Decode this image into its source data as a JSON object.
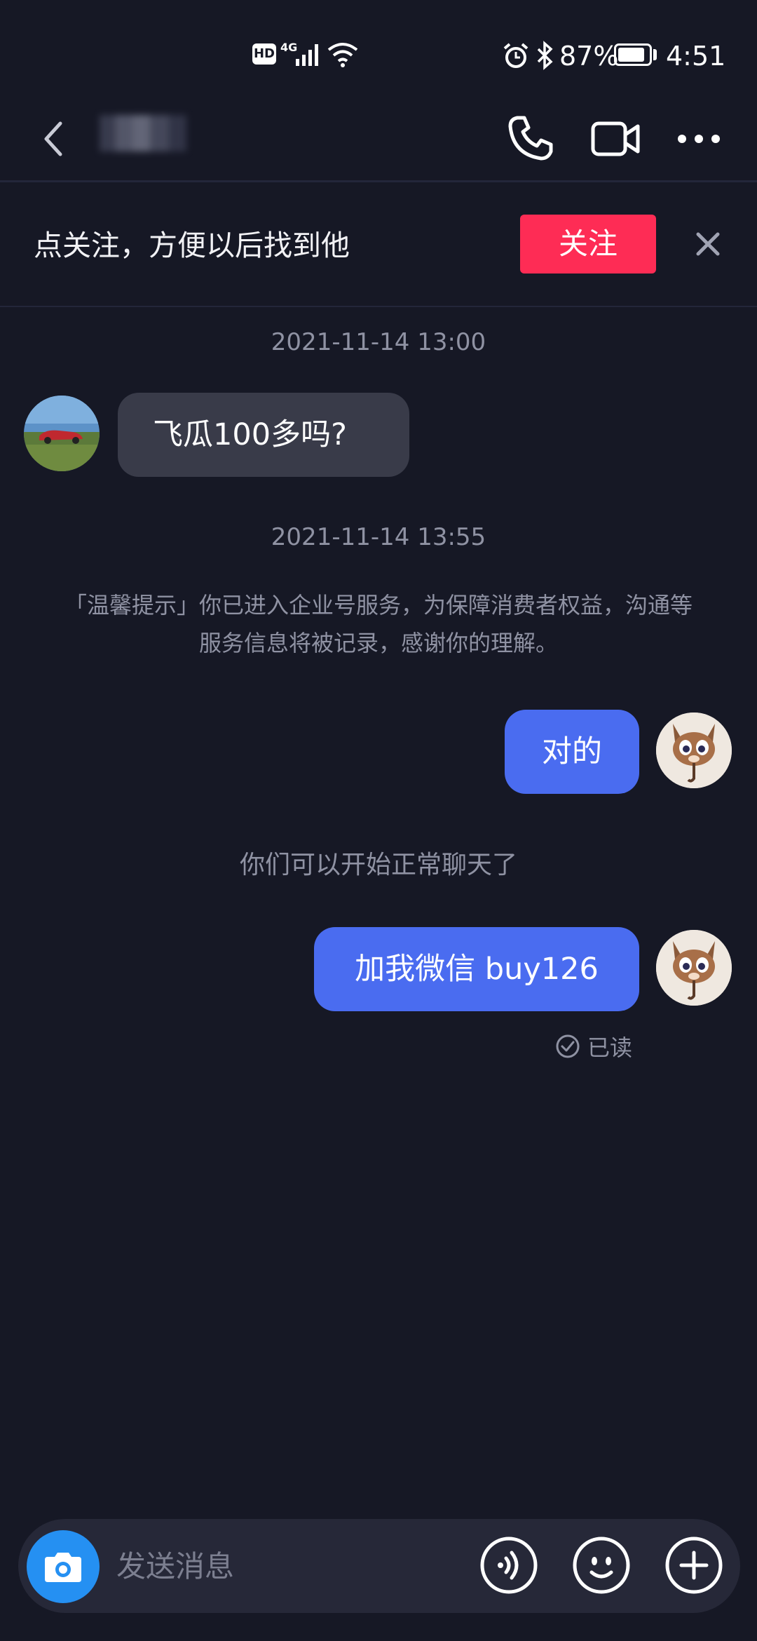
{
  "status_bar": {
    "signal_label": "HD",
    "network": "4G",
    "battery_percent": "87%",
    "battery_level": 0.87,
    "time": "4:51"
  },
  "header": {
    "icons": [
      "back-icon",
      "phone-icon",
      "video-icon",
      "more-icon"
    ]
  },
  "follow_banner": {
    "text": "点关注，方便以后找到他",
    "button_label": "关注",
    "accent_color": "#fe2c55"
  },
  "messages": {
    "timestamp_1": "2021-11-14 13:00",
    "incoming_1": "飞瓜100多吗?",
    "timestamp_2": "2021-11-14 13:55",
    "notice_line_1": "「温馨提示」你已进入企业号服务，为保障消费者权益，沟通等",
    "notice_line_2": "服务信息将被记录，感谢你的理解。",
    "outgoing_1": "对的",
    "system_notice": "你们可以开始正常聊天了",
    "outgoing_2": "加我微信 buy126",
    "read_status": "已读",
    "outgoing_color": "#4a6cf0"
  },
  "input_bar": {
    "placeholder": "发送消息",
    "icons": [
      "camera-icon",
      "voice-icon",
      "emoji-icon",
      "plus-icon"
    ]
  }
}
